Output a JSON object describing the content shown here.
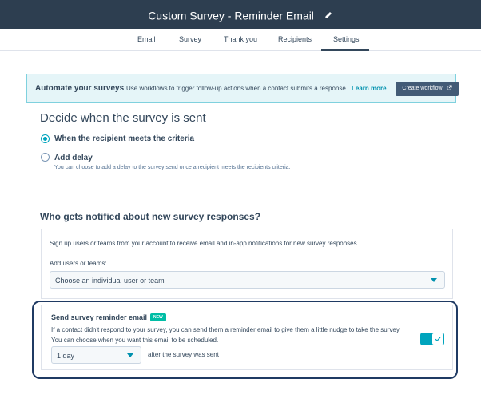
{
  "header": {
    "title": "Custom Survey - Reminder Email"
  },
  "tabs": [
    {
      "label": "Email"
    },
    {
      "label": "Survey"
    },
    {
      "label": "Thank you"
    },
    {
      "label": "Recipients"
    },
    {
      "label": "Settings",
      "active": true
    }
  ],
  "banner": {
    "title": "Automate your surveys",
    "text": "Use workflows to trigger follow-up actions when a contact submits a response.",
    "link": "Learn more",
    "button": "Create workflow"
  },
  "send_timing": {
    "heading": "Decide when the survey is sent",
    "options": [
      {
        "label": "When the recipient meets the criteria",
        "selected": true
      },
      {
        "label": "Add delay",
        "selected": false,
        "help": "You can choose to add a delay to the survey send once a recipient meets the recipients criteria."
      }
    ]
  },
  "notifications": {
    "heading": "Who gets notified about new survey responses?",
    "text": "Sign up users or teams from your account to receive email and in-app notifications for new survey responses.",
    "label": "Add users or teams:",
    "placeholder": "Choose an individual user or team"
  },
  "reminder": {
    "title": "Send survey reminder email",
    "badge": "NEW",
    "text": "If a contact didn't respond to your survey, you can send them a reminder email to give them a little nudge to take the survey. You can choose when you want this email to be scheduled.",
    "delay_value": "1 day",
    "after_text": "after the survey was sent",
    "enabled": true
  },
  "colors": {
    "header_bg": "#2d3e50",
    "accent": "#00a4bd",
    "badge": "#00bda5",
    "highlight_border": "#1f3a63"
  }
}
